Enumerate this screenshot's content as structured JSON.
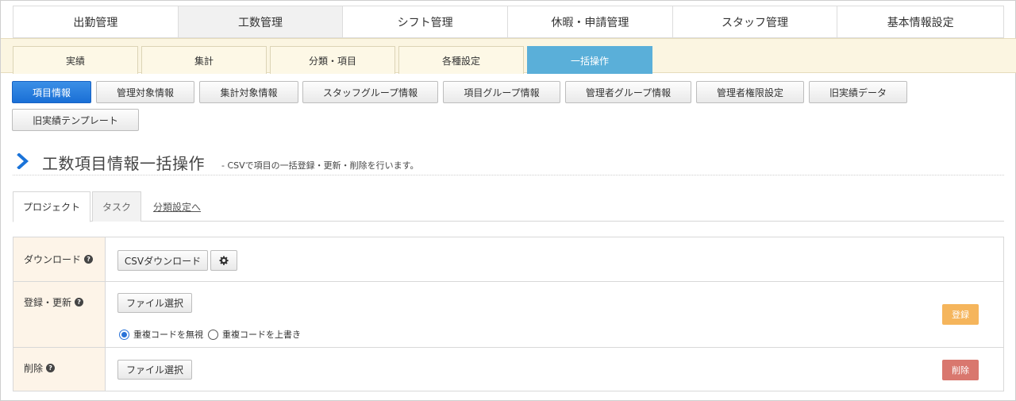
{
  "main_tabs": [
    "出勤管理",
    "工数管理",
    "シフト管理",
    "休暇・申請管理",
    "スタッフ管理",
    "基本情報設定"
  ],
  "sub_tabs": [
    "実績",
    "集計",
    "分類・項目",
    "各種設定",
    "一括操作"
  ],
  "info_buttons": [
    "項目情報",
    "管理対象情報",
    "集計対象情報",
    "スタッフグループ情報",
    "項目グループ情報",
    "管理者グループ情報",
    "管理者権限設定",
    "旧実績データ",
    "旧実績テンプレート"
  ],
  "page": {
    "title": "工数項目情報一括操作",
    "subtitle": "- CSVで項目の一括登録・更新・削除を行います。"
  },
  "inner_tabs": {
    "project": "プロジェクト",
    "task": "タスク",
    "category_link": "分類設定へ"
  },
  "form": {
    "download": {
      "label": "ダウンロード",
      "csv_button": "CSVダウンロード",
      "settings_icon": "gear-icon"
    },
    "register": {
      "label": "登録・更新",
      "file_button": "ファイル選択",
      "option_ignore": "重複コードを無視",
      "option_overwrite": "重複コードを上書き",
      "selected": "option_ignore",
      "submit": "登録"
    },
    "delete": {
      "label": "削除",
      "file_button": "ファイル選択",
      "submit": "削除"
    }
  },
  "colors": {
    "active_subtab": "#5aafd9",
    "primary_button": "#1a6fd6",
    "register_button": "#f5b55c",
    "delete_button": "#d9776e",
    "label_bg": "#fdf4e8",
    "band_bg": "#fbf5e1",
    "chevron": "#1a73d9"
  }
}
